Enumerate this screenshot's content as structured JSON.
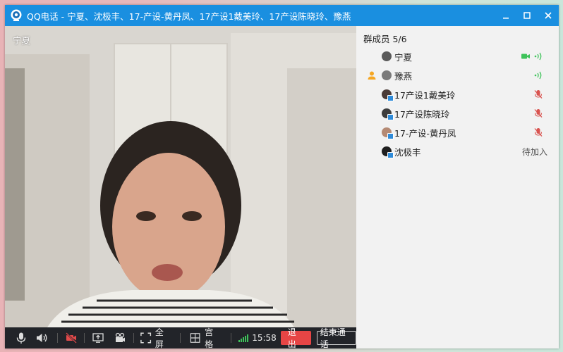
{
  "window": {
    "title": "QQ电话 - 宁夏、沈极丰、17-产设-黄丹凤、17产设1戴美玲、17产设陈晓玲、豫燕"
  },
  "video": {
    "participant_name": "宁夏"
  },
  "controls": {
    "fullscreen_label": "全屏",
    "grid_label": "宫格",
    "time": "15:58",
    "exit_label": "退出",
    "end_call_label": "结束通话"
  },
  "members": {
    "header": "群成员 5/6",
    "items": [
      {
        "name": "宁夏",
        "status": "video-voice"
      },
      {
        "name": "豫燕",
        "status": "voice",
        "host": true
      },
      {
        "name": "17产设1戴美玲",
        "status": "muted"
      },
      {
        "name": "17产设陈晓玲",
        "status": "muted"
      },
      {
        "name": "17-产设-黄丹凤",
        "status": "muted"
      },
      {
        "name": "沈极丰",
        "status": "pending",
        "status_text": "待加入"
      }
    ]
  },
  "colors": {
    "titlebar": "#1a8fe0",
    "accent_green": "#3ec35a",
    "exit_red": "#e64545",
    "mute_red": "#d9534f"
  }
}
